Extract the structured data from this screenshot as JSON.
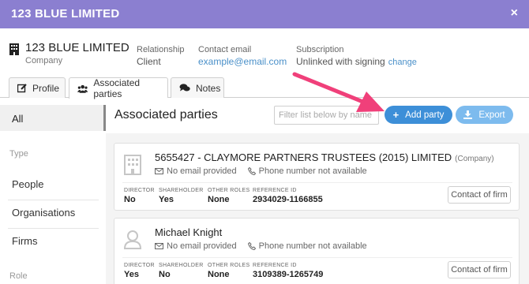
{
  "window": {
    "title": "123 BLUE LIMITED",
    "close_label": "×"
  },
  "company": {
    "name": "123 BLUE LIMITED",
    "type": "Company",
    "relationship_label": "Relationship",
    "relationship_value": "Client",
    "contact_label": "Contact email",
    "contact_value": "example@email.com",
    "subscription_label": "Subscription",
    "subscription_value": "Unlinked with signing",
    "subscription_change": "change"
  },
  "tabs": [
    {
      "label": "Profile",
      "icon": "edit-icon"
    },
    {
      "label": "Associated parties",
      "icon": "users-icon",
      "active": true
    },
    {
      "label": "Notes",
      "icon": "chat-icon"
    }
  ],
  "sidebar": {
    "all_label": "All",
    "type_heading": "Type",
    "type_items": [
      "People",
      "Organisations",
      "Firms"
    ],
    "role_heading": "Role"
  },
  "main": {
    "title": "Associated parties",
    "filter_placeholder": "Filter list below by name",
    "add_label": "Add party",
    "export_label": "Export"
  },
  "columns": {
    "director": "DIRECTOR",
    "shareholder": "SHAREHOLDER",
    "other_roles": "OTHER ROLES",
    "reference_id": "REFERENCE ID"
  },
  "parties": [
    {
      "name": "5655427 - CLAYMORE PARTNERS TRUSTEES (2015) LIMITED",
      "type": "(Company)",
      "email": "No email provided",
      "phone": "Phone number not available",
      "director": "No",
      "shareholder": "Yes",
      "other_roles": "None",
      "reference_id": "2934029-1166855",
      "action": "Contact of firm",
      "avatar": "building-icon"
    },
    {
      "name": "Michael Knight",
      "type": "",
      "email": "No email provided",
      "phone": "Phone number not available",
      "director": "Yes",
      "shareholder": "No",
      "other_roles": "None",
      "reference_id": "3109389-1265749",
      "action": "Contact of firm",
      "avatar": "person-icon"
    }
  ],
  "colors": {
    "header": "#8b7fd0",
    "primary_button": "#3d8fd8",
    "secondary_button": "#7dbbee",
    "link": "#4a90c9",
    "annotation_arrow": "#f0407a"
  }
}
